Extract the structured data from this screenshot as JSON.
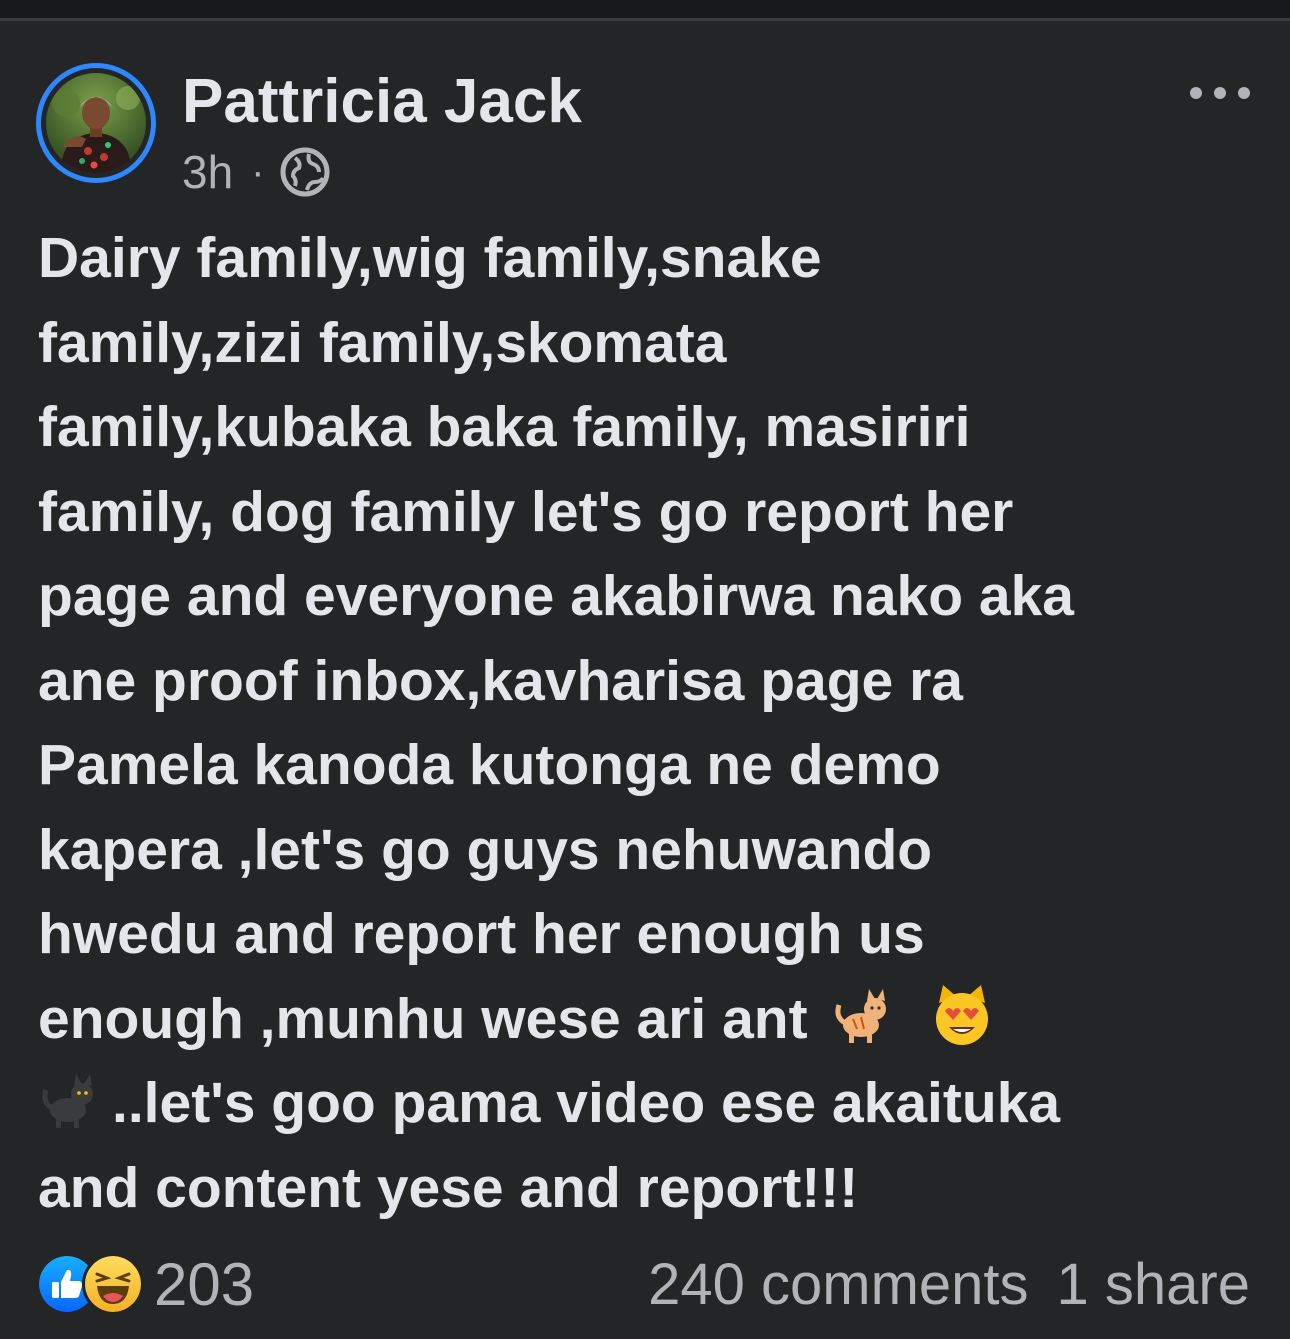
{
  "post": {
    "author": {
      "name": "Pattricia Jack",
      "avatar_alt": "profile-photo"
    },
    "timestamp": "3h",
    "separator": "·",
    "privacy_icon": "globe-icon",
    "more_icon": "ellipsis-icon",
    "text_lines": [
      "Dairy family,wig family,snake",
      "family,zizi family,skomata",
      "family,kubaka baka family, masiriri",
      "family, dog family let's go report her",
      "page and everyone akabirwa nako aka",
      "ane proof inbox,kavharisa page ra",
      "Pamela kanoda kutonga ne demo",
      "kapera ,let's go guys nehuwando",
      "hwedu and report her enough us"
    ],
    "emoji_line": {
      "text": "enough ,munhu wese ari ant",
      "emojis": [
        "cat-icon",
        "heart-eyes-cat-icon"
      ]
    },
    "cat_line": {
      "emoji": "black-cat-icon",
      "text": "..let's goo pama video ese akaituka"
    },
    "last_line": "and content yese and report!!!",
    "reactions": {
      "icons": [
        "like-icon",
        "haha-icon"
      ],
      "count": "203"
    },
    "comments": "240 comments",
    "shares": "1 share"
  },
  "colors": {
    "background": "#242526",
    "text_primary": "#e4e6eb",
    "text_secondary": "#b0b3b8",
    "accent": "#2d88ff"
  }
}
